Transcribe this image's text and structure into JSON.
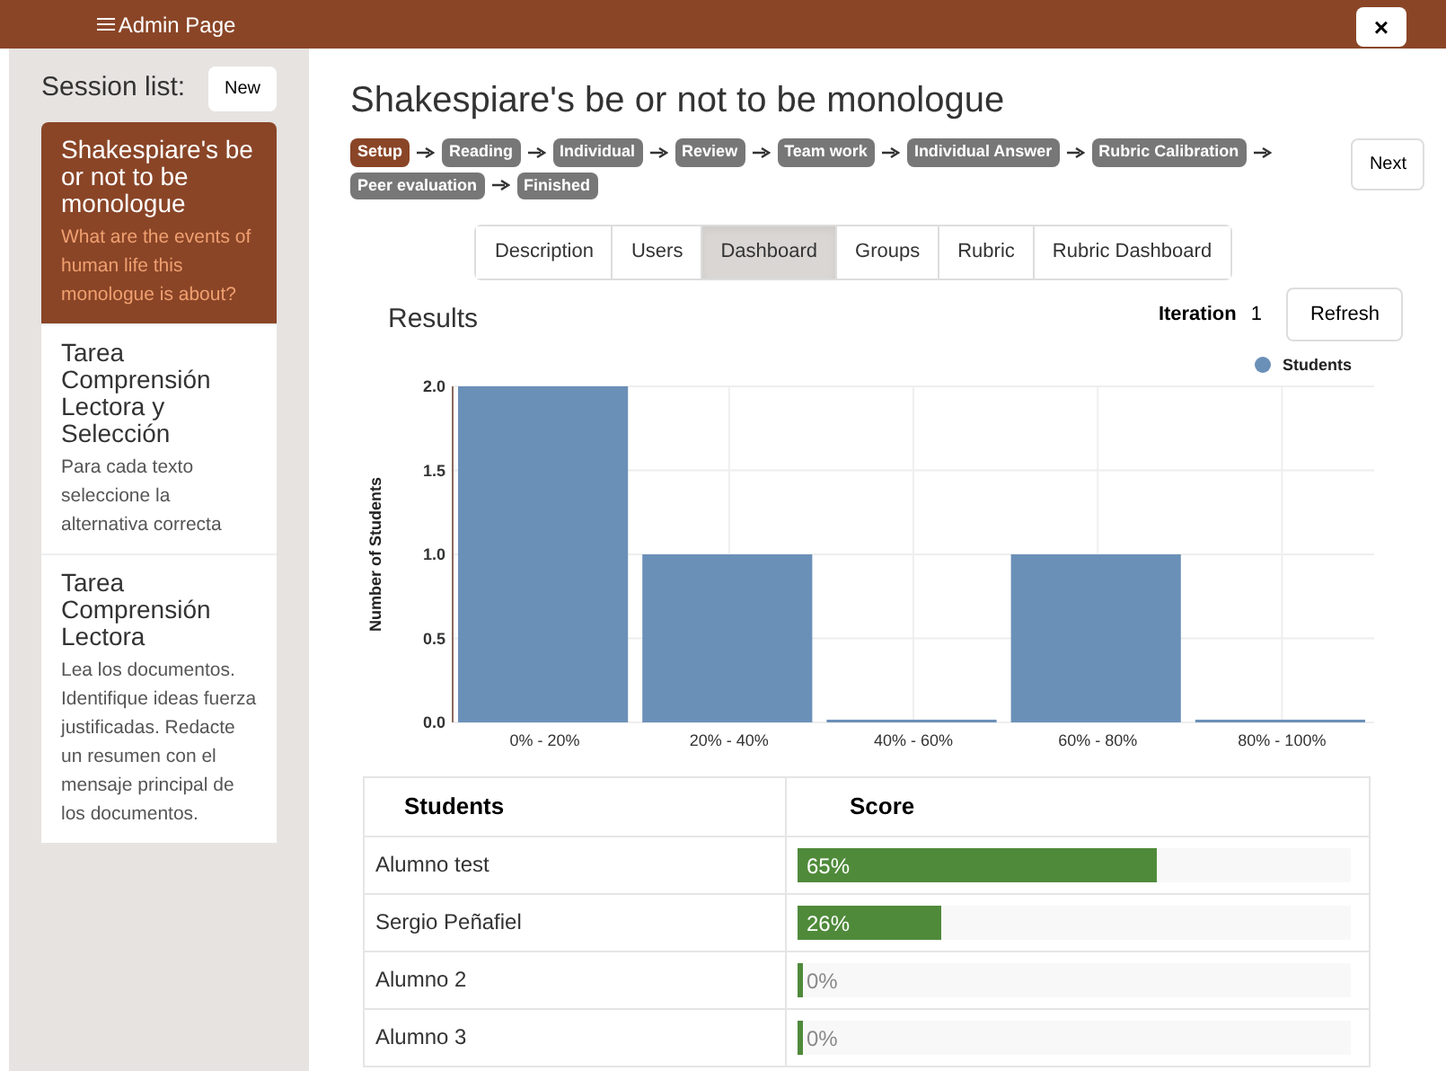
{
  "header": {
    "title": "Admin Page",
    "close": "×"
  },
  "sidebar": {
    "title": "Session list:",
    "new_button": "New",
    "sessions": [
      {
        "title": "Shakespiare's be or not to be monologue",
        "description": "What are the events of human life this monologue is about?",
        "selected": true
      },
      {
        "title": "Tarea Comprensión Lectora y Selección",
        "description": "Para cada texto seleccione la alternativa correcta",
        "selected": false
      },
      {
        "title": "Tarea Comprensión Lectora",
        "description": "Lea los documentos. Identifique ideas fuerza justificadas. Redacte un resumen con el mensaje principal de los documentos.",
        "selected": false
      }
    ]
  },
  "main": {
    "title": "Shakespiare's be or not to be monologue",
    "steps": [
      {
        "label": "Setup",
        "selected": true
      },
      {
        "label": "Reading",
        "selected": false
      },
      {
        "label": "Individual",
        "selected": false
      },
      {
        "label": "Review",
        "selected": false
      },
      {
        "label": "Team work",
        "selected": false
      },
      {
        "label": "Individual Answer",
        "selected": false
      },
      {
        "label": "Rubric Calibration",
        "selected": false
      },
      {
        "label": "Peer evaluation",
        "selected": false
      },
      {
        "label": "Finished",
        "selected": false
      }
    ],
    "next_button": "Next",
    "tabs": [
      {
        "label": "Description",
        "selected": false
      },
      {
        "label": "Users",
        "selected": false
      },
      {
        "label": "Dashboard",
        "selected": true
      },
      {
        "label": "Groups",
        "selected": false
      },
      {
        "label": "Rubric",
        "selected": false
      },
      {
        "label": "Rubric Dashboard",
        "selected": false
      }
    ],
    "results_title": "Results",
    "iteration_label": "Iteration",
    "iteration_value": "1",
    "refresh_button": "Refresh",
    "chart_data": {
      "type": "bar",
      "ylabel": "Number of Students",
      "categories": [
        "0% - 20%",
        "20% - 40%",
        "40% - 60%",
        "60% - 80%",
        "80% - 100%"
      ],
      "series": [
        {
          "name": "Students",
          "color": "#6b90b8",
          "values": [
            2,
            1,
            0,
            1,
            0
          ]
        }
      ],
      "grid": true,
      "ylim": [
        0,
        2
      ],
      "yticks": [
        {
          "value": 0,
          "label": "0.0"
        },
        {
          "value": 0.5,
          "label": "0.5"
        },
        {
          "value": 1,
          "label": "1.0"
        },
        {
          "value": 1.5,
          "label": "1.5"
        },
        {
          "value": 2,
          "label": "2.0"
        }
      ]
    },
    "table": {
      "columns": [
        "Students",
        "Score"
      ],
      "rows": [
        {
          "student": "Alumno test",
          "score": "65%",
          "level": 0.65
        },
        {
          "student": "Sergio Peñafiel",
          "score": "26%",
          "level": 0.26
        },
        {
          "student": "Alumno 2",
          "score": "0%",
          "level": 0
        },
        {
          "student": "Alumno 3",
          "score": "0%",
          "level": 0
        }
      ]
    }
  }
}
